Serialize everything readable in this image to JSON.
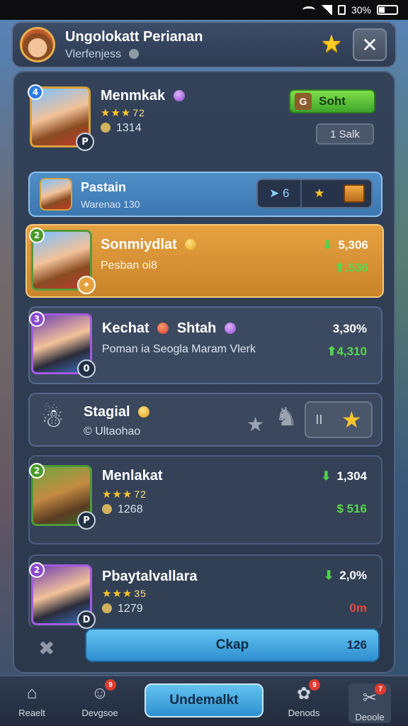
{
  "status_bar": {
    "battery": "30%"
  },
  "header": {
    "title": "Ungolokatt Perianan",
    "subtitle": "Vlerfenjess"
  },
  "cards": [
    {
      "name": "Menmkak",
      "badge_top": "4",
      "badge_bottom": "P",
      "stars_value": "72",
      "coin_value": "1314",
      "primary_button": "Soht",
      "primary_button_icon": "G",
      "secondary_button": "1 Salk"
    },
    {
      "name": "Pastain",
      "sub": "Warenao 130",
      "chip_value": "6"
    },
    {
      "name": "Sonmiydlat",
      "sub": "Pesban oi8",
      "badge_top": "2",
      "value_top": "5,306",
      "value_bottom": ".536"
    },
    {
      "name": "Kechat",
      "name_2": "Shtah",
      "sub": "Poman ia Seogla Maram Vlerk",
      "badge_top": "3",
      "badge_bottom": "0",
      "value_top": "3,30%",
      "value_bottom": "4,310"
    },
    {
      "name": "Stagial",
      "sub": "Ultaohao",
      "chip_value": "II"
    },
    {
      "name": "Menlakat",
      "badge_top": "2",
      "badge_bottom": "P",
      "stars_value": "72",
      "coin_value": "1268",
      "value_top": "1,304",
      "value_bottom": "516"
    },
    {
      "name": "Pbaytalvallara",
      "badge_top": "2",
      "badge_bottom": "D",
      "stars_value": "35",
      "coin_value": "1279",
      "value_top": "2,0%",
      "value_bottom": "0m"
    }
  ],
  "main_button": {
    "label": "Ckap",
    "value": "126"
  },
  "nav": [
    {
      "label": "Reaelt",
      "badge": ""
    },
    {
      "label": "Devgsoe",
      "badge": "9"
    },
    {
      "label": "Undemalkt",
      "badge": ""
    },
    {
      "label": "Denods",
      "badge": "9"
    },
    {
      "label": "Deoole",
      "badge": "7"
    }
  ],
  "colors": {
    "accent_blue": "#2e8fd0",
    "accent_orange": "#e5a140",
    "positive_green": "#58d64f",
    "negative_red": "#e24a3c"
  }
}
